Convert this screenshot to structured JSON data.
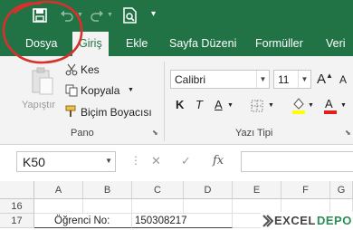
{
  "quick_access": {
    "icons": [
      "save-icon",
      "undo-icon",
      "redo-icon",
      "print-preview-icon",
      "customize-qat-icon"
    ]
  },
  "tabs": [
    {
      "label": "Dosya"
    },
    {
      "label": "Giriş"
    },
    {
      "label": "Ekle"
    },
    {
      "label": "Sayfa Düzeni"
    },
    {
      "label": "Formüller"
    },
    {
      "label": "Veri"
    }
  ],
  "pano": {
    "paste_label": "Yapıştır",
    "cut_label": "Kes",
    "copy_label": "Kopyala",
    "format_painter_label": "Biçim Boyacısı",
    "group_label": "Pano"
  },
  "font": {
    "name": "Calibri",
    "size": "11",
    "bold_label": "K",
    "italic_label": "T",
    "underline_label": "A",
    "group_label": "Yazı Tipi"
  },
  "formula_bar": {
    "name_box": "K50",
    "cancel_symbol": "✕",
    "enter_symbol": "✓",
    "fx_symbol": "fx"
  },
  "sheet": {
    "columns": [
      "A",
      "B",
      "C",
      "D",
      "E",
      "F",
      "G"
    ],
    "rows": [
      {
        "num": "16",
        "cells": {}
      },
      {
        "num": "17",
        "cells": {
          "A": "Öğrenci No:",
          "C": "150308217"
        }
      }
    ]
  },
  "watermark": "EXCEL DEPO",
  "colors": {
    "ribbon_green": "#217346",
    "annotation_red": "#d9302b"
  }
}
